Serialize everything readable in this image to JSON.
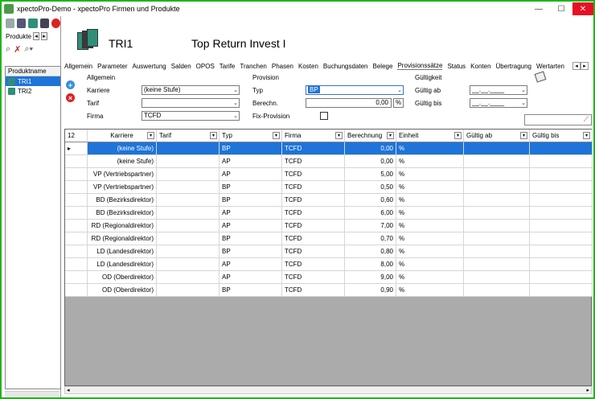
{
  "window": {
    "title": "xpectoPro-Demo - xpectoPro Firmen und Produkte",
    "minimize": "—",
    "maximize": "☐",
    "close": "✕"
  },
  "left": {
    "produkte_label": "Produkte",
    "nav_prev": "◂",
    "nav_next": "▸",
    "tree_header": "Produktname",
    "items": [
      {
        "label": "TRI1",
        "selected": true
      },
      {
        "label": "TRI2",
        "selected": false
      }
    ]
  },
  "product": {
    "code": "TRI1",
    "name": "Top Return Invest I"
  },
  "tabs": [
    "Allgemein",
    "Parameter",
    "Auswertung",
    "Salden",
    "OPOS",
    "Tarife",
    "Tranchen",
    "Phasen",
    "Kosten",
    "Buchungsdaten",
    "Belege",
    "Provisionssätze",
    "Status",
    "Konten",
    "Übertragung",
    "Wertarten"
  ],
  "active_tab": "Provisionssätze",
  "form": {
    "allgemein": {
      "title": "Allgemein",
      "karriere_label": "Karriere",
      "karriere_value": "(keine Stufe)",
      "tarif_label": "Tarif",
      "tarif_value": "",
      "firma_label": "Firma",
      "firma_value": "TCFD"
    },
    "provision": {
      "title": "Provision",
      "typ_label": "Typ",
      "typ_value": "BP",
      "berechn_label": "Berechn.",
      "berechn_value": "0,00",
      "berechn_unit": "%",
      "fix_label": "Fix-Provision"
    },
    "gueltigkeit": {
      "title": "Gültigkeit",
      "ab_label": "Gültig ab",
      "ab_value": "__.__.____",
      "bis_label": "Gültig bis",
      "bis_value": "__.__.____"
    }
  },
  "grid": {
    "count": "12",
    "columns": [
      "Karriere",
      "Tarif",
      "Typ",
      "Firma",
      "Berechnung",
      "Einheit",
      "Gültig ab",
      "Gültig bis"
    ],
    "rows": [
      [
        "(keine Stufe)",
        "",
        "BP",
        "TCFD",
        "0,00",
        "%",
        "",
        ""
      ],
      [
        "(keine Stufe)",
        "",
        "AP",
        "TCFD",
        "0,00",
        "%",
        "",
        ""
      ],
      [
        "VP (Vertriebspartner)",
        "",
        "AP",
        "TCFD",
        "5,00",
        "%",
        "",
        ""
      ],
      [
        "VP (Vertriebspartner)",
        "",
        "BP",
        "TCFD",
        "0,50",
        "%",
        "",
        ""
      ],
      [
        "BD (Bezirksdirektor)",
        "",
        "BP",
        "TCFD",
        "0,60",
        "%",
        "",
        ""
      ],
      [
        "BD (Bezirksdirektor)",
        "",
        "AP",
        "TCFD",
        "6,00",
        "%",
        "",
        ""
      ],
      [
        "RD (Regionaldirektor)",
        "",
        "AP",
        "TCFD",
        "7,00",
        "%",
        "",
        ""
      ],
      [
        "RD (Regionaldirektor)",
        "",
        "BP",
        "TCFD",
        "0,70",
        "%",
        "",
        ""
      ],
      [
        "LD (Landesdirektor)",
        "",
        "BP",
        "TCFD",
        "0,80",
        "%",
        "",
        ""
      ],
      [
        "LD (Landesdirektor)",
        "",
        "AP",
        "TCFD",
        "8,00",
        "%",
        "",
        ""
      ],
      [
        "OD (Oberdirektor)",
        "",
        "AP",
        "TCFD",
        "9,00",
        "%",
        "",
        ""
      ],
      [
        "OD (Oberdirektor)",
        "",
        "BP",
        "TCFD",
        "0,90",
        "%",
        "",
        ""
      ]
    ],
    "selected_row": 0
  },
  "colors": {
    "frame": "#22b31c",
    "selection": "#1e74d8",
    "close": "#e81123"
  }
}
